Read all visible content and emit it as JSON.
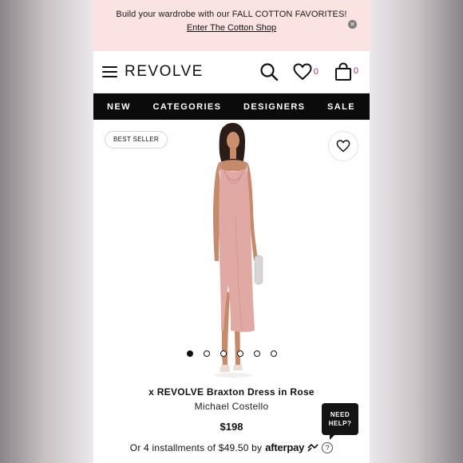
{
  "promo": {
    "message": "Build your wardrobe with our FALL COTTON FAVORITES!",
    "link": "Enter The Cotton Shop",
    "close_icon": "close-icon"
  },
  "header": {
    "logo": "REVOLVE",
    "wishlist_count": "0",
    "bag_count": "0",
    "icons": [
      "menu-icon",
      "search-icon",
      "heart-icon",
      "bag-icon"
    ]
  },
  "nav": {
    "items": [
      "NEW",
      "CATEGORIES",
      "DESIGNERS",
      "SALE"
    ]
  },
  "product": {
    "badge": "BEST SELLER",
    "title": "x REVOLVE Braxton Dress in Rose",
    "brand": "Michael Costello",
    "price": "$198",
    "installments_prefix": "Or 4 installments of $49.50 by",
    "afterpay_label": "afterpay",
    "help_icon": "?",
    "carousel_total": 6,
    "carousel_active": 1,
    "dress_color": "#e0a9a3"
  },
  "help_button": {
    "line1": "NEED",
    "line2": "HELP?"
  },
  "colors": {
    "promo_bg": "#fbe3e2",
    "nav_bg": "#0b0b0b",
    "count_accent": "#b0356d"
  }
}
